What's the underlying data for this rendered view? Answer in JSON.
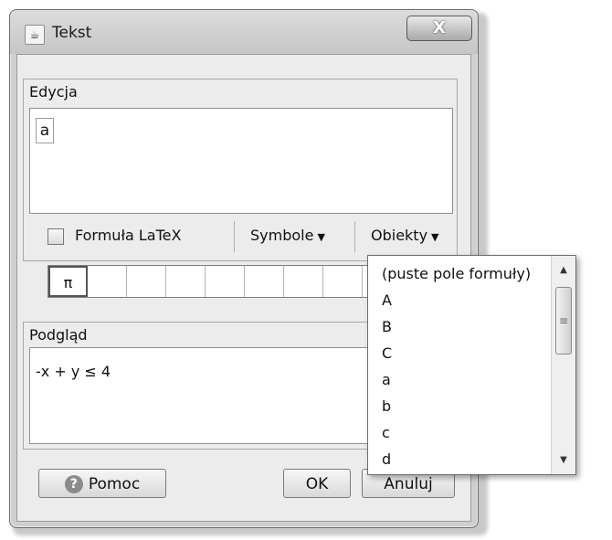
{
  "window": {
    "title": "Tekst",
    "app_icon": "java-cup-icon",
    "close_icon": "close-icon",
    "close_glyph": "X"
  },
  "edit": {
    "label": "Edycja",
    "content": "a"
  },
  "toolbar": {
    "latex_label": "Formuła LaTeX",
    "latex_checked": false,
    "symbols_label": "Symbole",
    "objects_label": "Obiekty",
    "dropdown_arrow": "▼"
  },
  "symbols": {
    "cells": [
      "π",
      "",
      "",
      "",
      "",
      "",
      "",
      "",
      ""
    ]
  },
  "preview": {
    "label": "Podgląd",
    "content": "-x + y ≤ 4"
  },
  "buttons": {
    "help": "Pomoc",
    "help_glyph": "?",
    "ok": "OK",
    "cancel": "Anuluj"
  },
  "objects_dropdown": {
    "items": [
      "(puste pole formuły)",
      "A",
      "B",
      "C",
      "a",
      "b",
      "c",
      "d"
    ],
    "scroll_up": "▲",
    "scroll_down": "▼",
    "thumb_grip": "≡"
  }
}
